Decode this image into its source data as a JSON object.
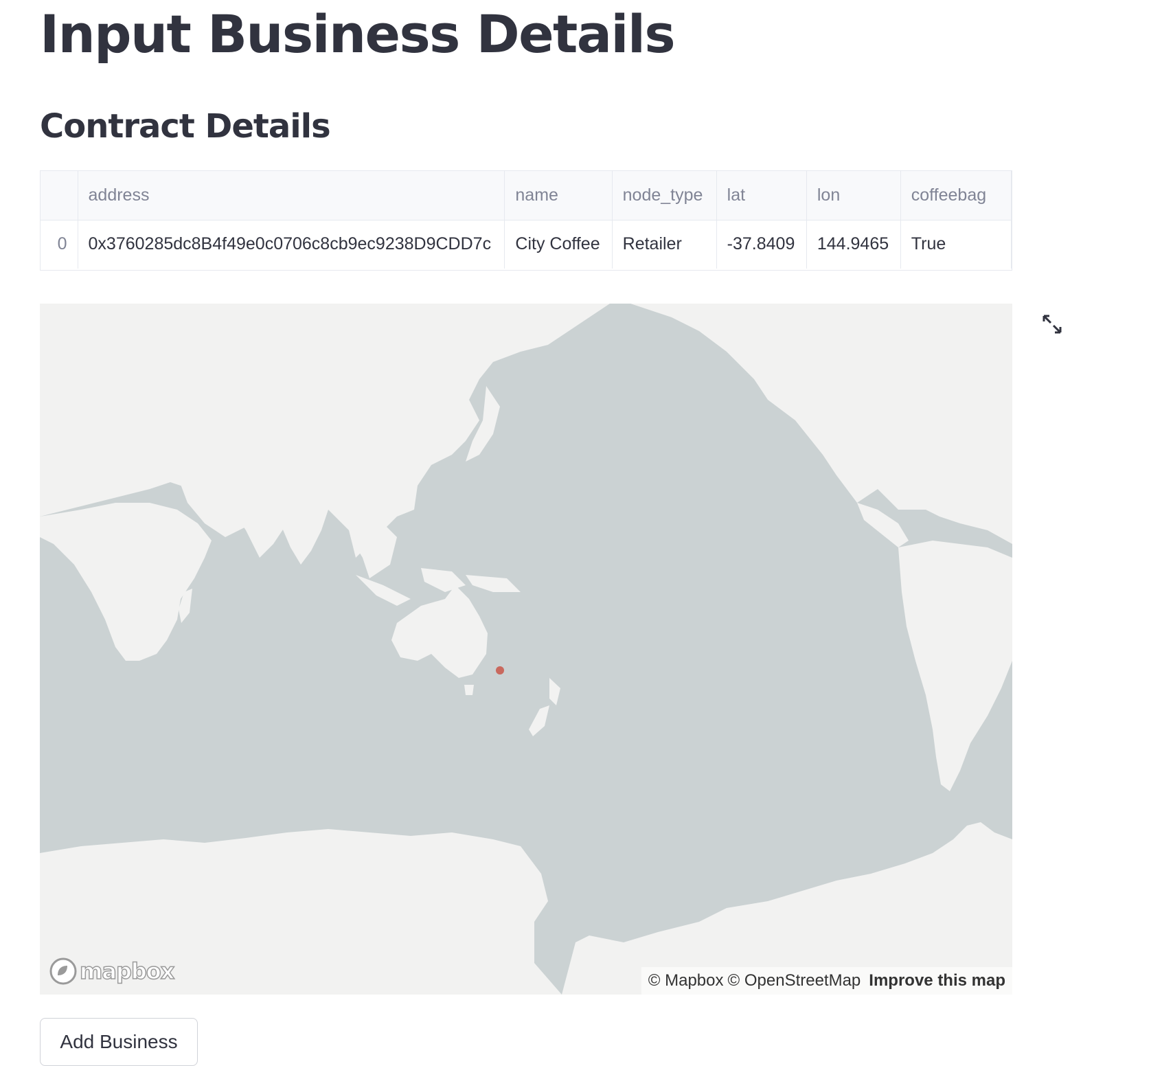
{
  "page": {
    "title": "Input Business Details",
    "section_title": "Contract Details"
  },
  "table": {
    "columns": [
      "",
      "address",
      "name",
      "node_type",
      "lat",
      "lon",
      "coffeebag"
    ],
    "rows": [
      {
        "index": "0",
        "address": "0x3760285dc8B4f49e0c0706c8cb9ec9238D9CDD7c",
        "name": "City Coffee",
        "node_type": "Retailer",
        "lat": "-37.8409",
        "lon": "144.9465",
        "coffeebag": "True"
      }
    ]
  },
  "map": {
    "ocean_color": "#cbd2d3",
    "land_color": "#f2f2f1",
    "marker_color": "#c9695e",
    "marker": {
      "lat": -37.8409,
      "lon": 144.9465
    },
    "logo_text": "mapbox",
    "attribution": {
      "mapbox": "© Mapbox",
      "osm": "© OpenStreetMap",
      "improve": "Improve this map"
    },
    "fullscreen_icon": "expand-icon"
  },
  "actions": {
    "add_business_label": "Add Business"
  }
}
